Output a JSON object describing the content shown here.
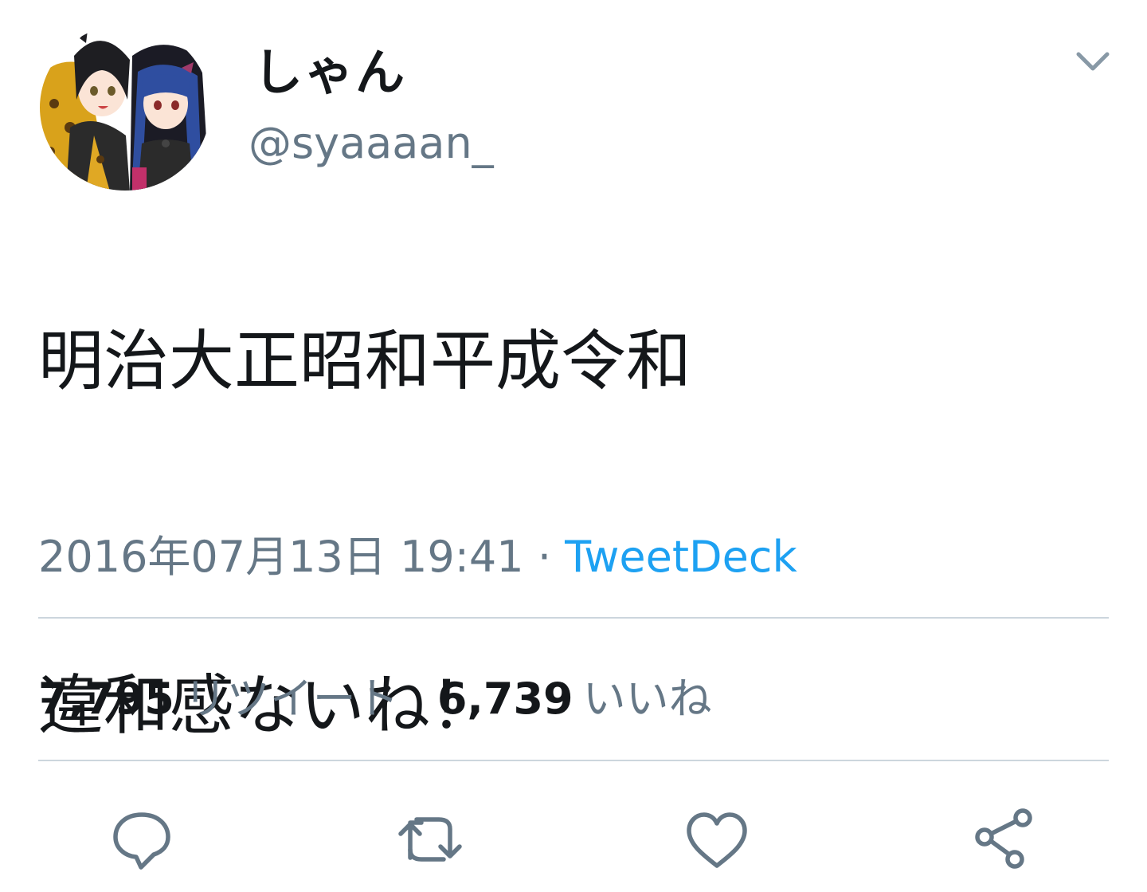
{
  "author": {
    "display_name": "しゃん",
    "handle": "@syaaaan_",
    "avatar_icon": "user-avatar"
  },
  "menu": {
    "icon": "chevron-down-icon"
  },
  "tweet": {
    "lines": [
      "明治大正昭和平成令和",
      "",
      "違和感ないね！"
    ],
    "timestamp": "2016年07月13日 19:41",
    "separator": "·",
    "source": "TweetDeck"
  },
  "stats": {
    "retweets_count": "7,795",
    "retweets_label": "リツイート",
    "likes_count": "6,739",
    "likes_label": "いいね"
  },
  "actions": [
    {
      "icon": "reply-icon"
    },
    {
      "icon": "retweet-icon"
    },
    {
      "icon": "like-icon"
    },
    {
      "icon": "share-icon"
    }
  ],
  "colors": {
    "text_primary": "#14171a",
    "text_secondary": "#657786",
    "link": "#1da1f2",
    "divider": "#ccd6dd"
  }
}
